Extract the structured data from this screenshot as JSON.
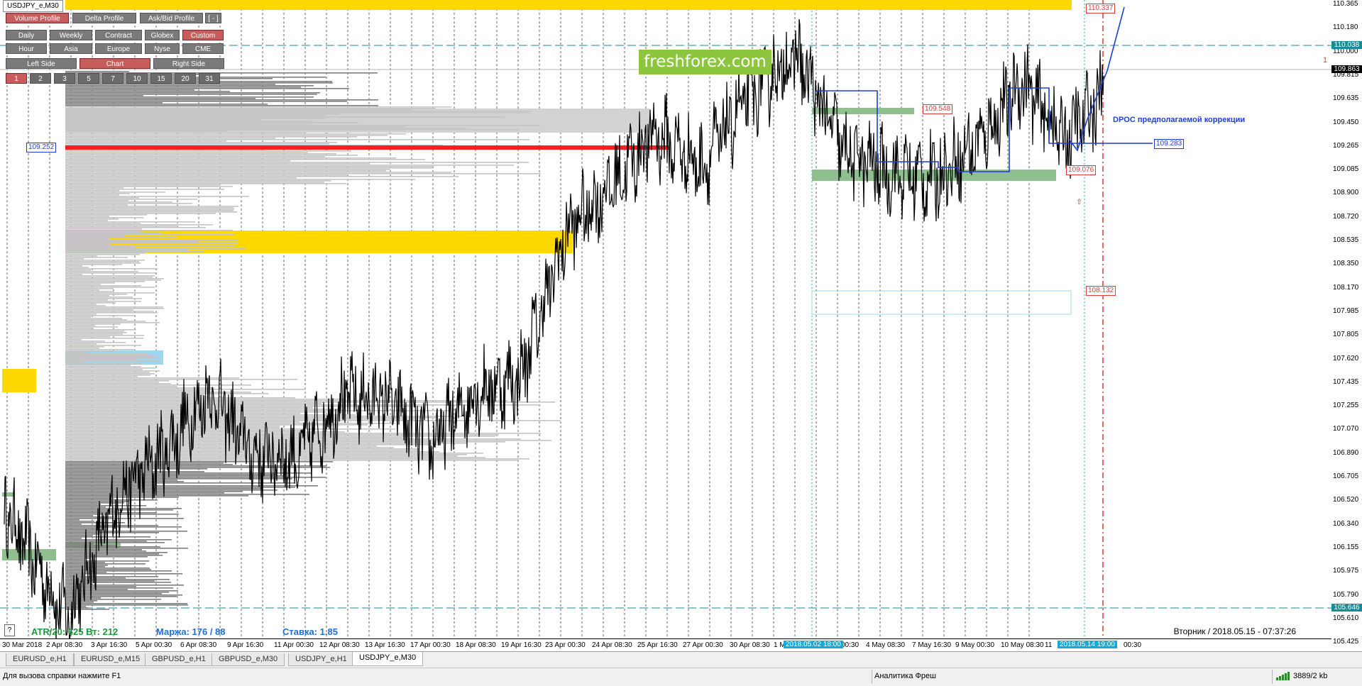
{
  "window": {
    "symbol_label": "USDJPY_e,M30"
  },
  "logo": {
    "text": "freshforex.com"
  },
  "toolbar": {
    "row1": [
      {
        "label": "Volume Profile",
        "active": true
      },
      {
        "label": "Delta Profile",
        "active": false
      },
      {
        "label": "Ask/Bid Profile",
        "active": false
      },
      {
        "label": "[ - ]",
        "active": false
      }
    ],
    "row2": [
      {
        "label": "Daily",
        "active": false
      },
      {
        "label": "Weekly",
        "active": false
      },
      {
        "label": "Contract",
        "active": false
      },
      {
        "label": "Globex",
        "active": false
      },
      {
        "label": "Custom",
        "active": true
      }
    ],
    "row3": [
      {
        "label": "Hour",
        "active": false
      },
      {
        "label": "Asia",
        "active": false
      },
      {
        "label": "Europe",
        "active": false
      },
      {
        "label": "Nyse",
        "active": false
      },
      {
        "label": "CME",
        "active": false
      }
    ],
    "row4": [
      {
        "label": "Left Side",
        "active": false
      },
      {
        "label": "Chart",
        "active": true
      },
      {
        "label": "Right Side",
        "active": false
      }
    ],
    "row5": [
      {
        "label": "1",
        "active": true
      },
      {
        "label": "2",
        "active": false
      },
      {
        "label": "3",
        "active": false
      },
      {
        "label": "5",
        "active": false
      },
      {
        "label": "7",
        "active": false
      },
      {
        "label": "10",
        "active": false
      },
      {
        "label": "15",
        "active": false
      },
      {
        "label": "20",
        "active": false
      },
      {
        "label": "31",
        "active": false
      }
    ]
  },
  "price_axis": {
    "ticks": [
      "110.365",
      "110.180",
      "110.000",
      "109.815",
      "109.635",
      "109.450",
      "109.265",
      "109.085",
      "108.900",
      "108.720",
      "108.535",
      "108.350",
      "108.170",
      "107.985",
      "107.805",
      "107.620",
      "107.435",
      "107.255",
      "107.070",
      "106.890",
      "106.705",
      "106.520",
      "106.340",
      "106.155",
      "105.975",
      "105.790",
      "105.610",
      "105.425"
    ],
    "tags": [
      {
        "text": "110.038",
        "color": "#1a8a9a"
      },
      {
        "text": "109.863",
        "color": "#000000"
      },
      {
        "text": "105.646",
        "color": "#1a8a9a"
      }
    ]
  },
  "levels": [
    {
      "name": "level-110337",
      "text": "110.337",
      "color": "#e03a3a"
    },
    {
      "name": "level-109548",
      "text": "109.548",
      "color": "#e03a3a"
    },
    {
      "name": "level-109283",
      "text": "109.283",
      "color": "#1d3fd6"
    },
    {
      "name": "level-109076",
      "text": "109.076",
      "color": "#e03a3a"
    },
    {
      "name": "level-108132",
      "text": "108.132",
      "color": "#e03a3a"
    },
    {
      "name": "level-109252",
      "text": "109.252",
      "color": "#1d3fd6"
    }
  ],
  "annotation": {
    "text": "DPOC предполагаемой коррекции"
  },
  "one_marker": "1",
  "time_axis": {
    "ticks": [
      "30 Mar 2018",
      "2 Apr 08:30",
      "3 Apr 16:30",
      "5 Apr 00:30",
      "6 Apr 08:30",
      "9 Apr 16:30",
      "11 Apr 00:30",
      "12 Apr 08:30",
      "13 Apr 16:30",
      "17 Apr 00:30",
      "18 Apr 08:30",
      "19 Apr 16:30",
      "23 Apr 00:30",
      "24 Apr 08:30",
      "25 Apr 16:30",
      "27 Apr 00:30",
      "30 Apr 08:30",
      "1 M",
      "00:30",
      "4 May 08:30",
      "7 May 16:30",
      "9 May 00:30",
      "10 May 08:30",
      "11",
      "00:30"
    ],
    "highlight1": "2018.05.02 18:00",
    "highlight2": "2018.05.14 19:00"
  },
  "info": {
    "atr": "ATR/20: 625  Вт: 212",
    "margin": "Маржа: 176 / 88",
    "rate": "Ставка: 1.85",
    "datetime": "Вторник  /  2018.05.15  -  07:37:26"
  },
  "help_box": "?",
  "tabs": [
    {
      "label": "EURUSD_e,H1",
      "active": false
    },
    {
      "label": "EURUSD_e,M15",
      "active": false
    },
    {
      "label": "GBPUSD_e,H1",
      "active": false
    },
    {
      "label": "GBPUSD_e,M30",
      "active": false
    },
    {
      "label": "USDJPY_e,H1",
      "active": false
    },
    {
      "label": "USDJPY_e,M30",
      "active": true
    }
  ],
  "status_bar": {
    "help": "Для вызова справки нажмите F1",
    "profile": "Аналитика Фреш",
    "traffic": "3889/2 kb"
  },
  "colors": {
    "price_line": "#000000",
    "dpoc_line": "#1d3fd6",
    "poc_red": "#ff1e1e",
    "yellow_zone": "#ffd800",
    "green_zone": "#8fbf8f",
    "grid_dash": "#000000"
  },
  "chart_data": {
    "type": "line",
    "title": "USDJPY_e,M30",
    "ylim": [
      105.425,
      110.365
    ],
    "price_waypoints": [
      [
        "30 Mar 2018",
        106.45
      ],
      [
        "2 Apr 08:30",
        105.6
      ],
      [
        "3 Apr 16:30",
        106.55
      ],
      [
        "5 Apr 00:30",
        106.9
      ],
      [
        "6 Apr 08:30",
        107.35
      ],
      [
        "9 Apr 16:30",
        106.85
      ],
      [
        "11 Apr 00:30",
        106.85
      ],
      [
        "12 Apr 08:30",
        107.3
      ],
      [
        "13 Apr 16:30",
        107.3
      ],
      [
        "17 Apr 00:30",
        106.95
      ],
      [
        "18 Apr 08:30",
        107.35
      ],
      [
        "19 Apr 16:30",
        107.45
      ],
      [
        "23 Apr 00:30",
        108.6
      ],
      [
        "24 Apr 08:30",
        108.95
      ],
      [
        "25 Apr 16:30",
        109.35
      ],
      [
        "27 Apr 00:30",
        109.1
      ],
      [
        "30 Apr 08:30",
        109.6
      ],
      [
        "1 M",
        109.95
      ],
      [
        "00:30",
        109.2
      ],
      [
        "4 May 08:30",
        109.05
      ],
      [
        "7 May 16:30",
        109.0
      ],
      [
        "9 May 00:30",
        109.3
      ],
      [
        "10 May 08:30",
        109.75
      ],
      [
        "11",
        109.3
      ],
      [
        "00:30",
        109.65
      ]
    ],
    "dpoc_projection": [
      109.283,
      110.337
    ]
  }
}
